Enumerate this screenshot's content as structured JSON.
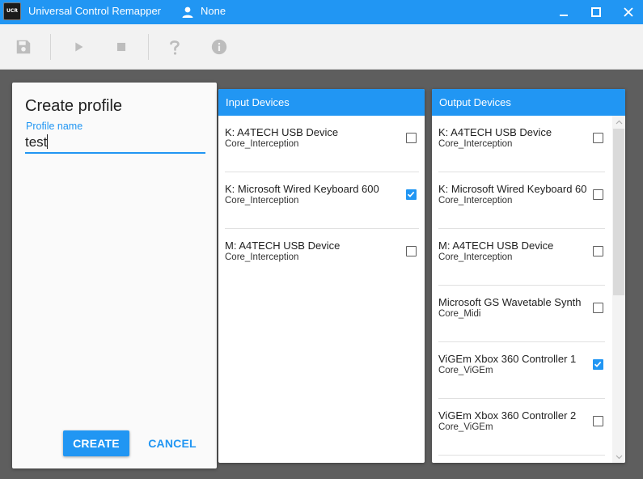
{
  "window": {
    "title": "Universal Control Remapper",
    "app_icon_text": "UCR",
    "user_name": "None",
    "icons": {
      "app": "ucr-chip-icon",
      "user": "person-icon",
      "minimize": "minimize-icon",
      "maximize": "maximize-icon",
      "close": "close-icon"
    }
  },
  "toolbar": {
    "buttons": [
      {
        "icon": "save-icon",
        "enabled": false
      },
      {
        "icon": "play-icon",
        "enabled": false
      },
      {
        "icon": "stop-icon",
        "enabled": false
      },
      {
        "icon": "help-icon",
        "enabled": false
      },
      {
        "icon": "info-icon",
        "enabled": false
      }
    ]
  },
  "create_profile": {
    "title": "Create profile",
    "field_label": "Profile name",
    "field_value": "test",
    "create_label": "CREATE",
    "cancel_label": "CANCEL"
  },
  "input_devices": {
    "header": "Input Devices",
    "items": [
      {
        "name": "K: A4TECH USB Device",
        "provider": "Core_Interception",
        "checked": false
      },
      {
        "name": "K: Microsoft Wired Keyboard 600",
        "provider": "Core_Interception",
        "checked": true
      },
      {
        "name": "M: A4TECH USB Device",
        "provider": "Core_Interception",
        "checked": false
      }
    ]
  },
  "output_devices": {
    "header": "Output Devices",
    "items": [
      {
        "name": "K: A4TECH USB Device",
        "provider": "Core_Interception",
        "checked": false
      },
      {
        "name": "K: Microsoft Wired Keyboard 60",
        "provider": "Core_Interception",
        "checked": false
      },
      {
        "name": "M: A4TECH USB Device",
        "provider": "Core_Interception",
        "checked": false
      },
      {
        "name": "Microsoft GS Wavetable Synth",
        "provider": "Core_Midi",
        "checked": false
      },
      {
        "name": "ViGEm Xbox 360 Controller 1",
        "provider": "Core_ViGEm",
        "checked": true
      },
      {
        "name": "ViGEm Xbox 360 Controller 2",
        "provider": "Core_ViGEm",
        "checked": false
      }
    ]
  },
  "colors": {
    "accent": "#2196f3",
    "toolbar_bg": "#f2f2f2",
    "backdrop": "#5e5e5e"
  }
}
